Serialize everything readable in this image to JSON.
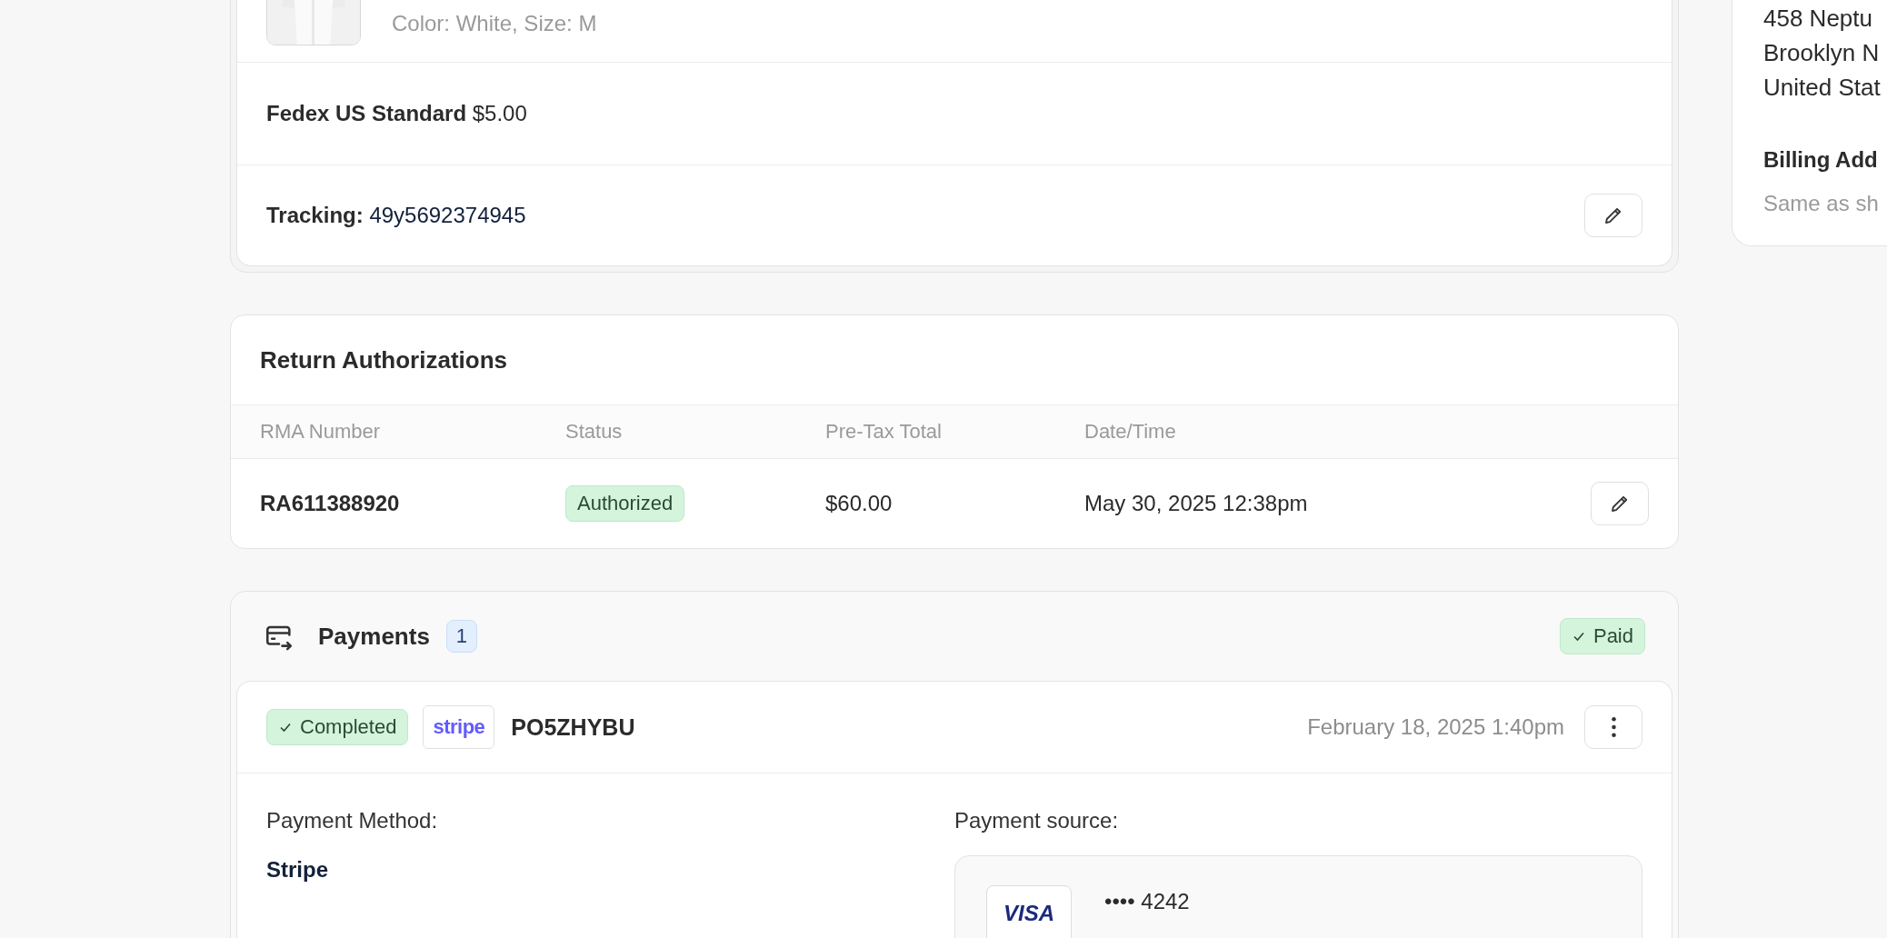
{
  "order_items": {
    "items": [
      {
        "variant": "Color: White, Size: M"
      }
    ],
    "shipping": {
      "carrier": "Fedex US Standard",
      "price": "$5.00"
    },
    "tracking": {
      "label": "Tracking:",
      "number": "49y5692374945"
    }
  },
  "returns": {
    "title": "Return Authorizations",
    "columns": [
      "RMA Number",
      "Status",
      "Pre-Tax Total",
      "Date/Time"
    ],
    "rows": [
      {
        "rma": "RA611388920",
        "status": "Authorized",
        "total": "$60.00",
        "date": "May 30, 2025 12:38pm"
      }
    ]
  },
  "payments": {
    "title": "Payments",
    "count": "1",
    "status": "Paid",
    "entries": [
      {
        "status": "Completed",
        "provider": "stripe",
        "id": "PO5ZHYBU",
        "date": "February 18, 2025 1:40pm",
        "method_label": "Payment Method:",
        "method": "Stripe",
        "source_label": "Payment source:",
        "card_brand": "VISA",
        "card_number": "•••• 4242"
      }
    ]
  },
  "address": {
    "lines": [
      "458 Neptu",
      "Brooklyn N",
      "United Stat"
    ],
    "billing_title": "Billing Add",
    "billing_value": "Same as sh"
  }
}
